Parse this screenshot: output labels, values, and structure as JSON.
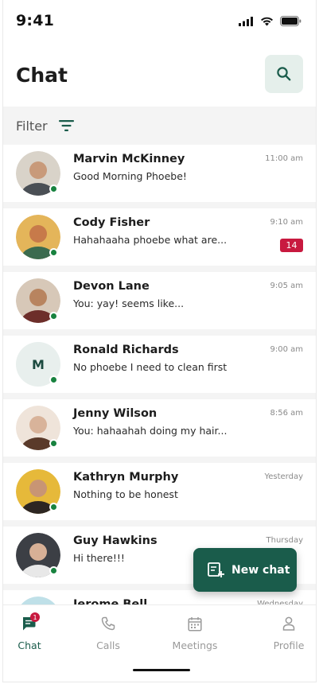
{
  "status_bar": {
    "time": "9:41"
  },
  "header": {
    "title": "Chat"
  },
  "filter": {
    "label": "Filter"
  },
  "chats": [
    {
      "name": "Marvin McKinney",
      "preview": "Good Morning Phoebe!",
      "time": "11:00 am",
      "unread": "",
      "online": true,
      "avatar_initial": "",
      "avatar_colors": [
        "#c89a7a",
        "#4a4f55",
        "#d9d3c9"
      ]
    },
    {
      "name": "Cody Fisher",
      "preview": "Hahahaaha phoebe what are...",
      "time": "9:10 am",
      "unread": "14",
      "online": true,
      "avatar_initial": "",
      "avatar_colors": [
        "#c77a4a",
        "#3b6b4e",
        "#e4b55a"
      ]
    },
    {
      "name": "Devon Lane",
      "preview": "You: yay! seems like...",
      "time": "9:05 am",
      "unread": "",
      "online": true,
      "avatar_initial": "",
      "avatar_colors": [
        "#b8845f",
        "#6d2e2a",
        "#d7c8b8"
      ]
    },
    {
      "name": "Ronald Richards",
      "preview": "No phoebe I need to clean first",
      "time": "9:00 am",
      "unread": "",
      "online": true,
      "avatar_initial": "M",
      "avatar_colors": []
    },
    {
      "name": "Jenny Wilson",
      "preview": "You: hahaahah doing my hair...",
      "time": "8:56 am",
      "unread": "",
      "online": true,
      "avatar_initial": "",
      "avatar_colors": [
        "#d8b39a",
        "#5a3a2a",
        "#efe4da"
      ]
    },
    {
      "name": "Kathryn Murphy",
      "preview": "Nothing to be honest",
      "time": "Yesterday",
      "unread": "",
      "online": true,
      "avatar_initial": "",
      "avatar_colors": [
        "#c89574",
        "#2d2622",
        "#e6b93a"
      ]
    },
    {
      "name": "Guy Hawkins",
      "preview": "Hi there!!!",
      "time": "Thursday",
      "unread": "",
      "online": true,
      "avatar_initial": "",
      "avatar_colors": [
        "#d7b096",
        "#e8e8e8",
        "#3c3f45"
      ]
    },
    {
      "name": "Jerome Bell",
      "preview": "",
      "time": "Wednesday",
      "unread": "",
      "online": false,
      "avatar_initial": "",
      "avatar_colors": [
        "#bfe0e8",
        "#bfe0e8",
        "#bfe0e8"
      ]
    }
  ],
  "fab": {
    "label": "New chat"
  },
  "bottom_nav": {
    "items": [
      {
        "label": "Chat",
        "icon": "chat-icon",
        "badge": "1",
        "active": true
      },
      {
        "label": "Calls",
        "icon": "phone-icon",
        "badge": "",
        "active": false
      },
      {
        "label": "Meetings",
        "icon": "calendar-icon",
        "badge": "",
        "active": false
      },
      {
        "label": "Profile",
        "icon": "person-icon",
        "badge": "",
        "active": false
      }
    ]
  },
  "colors": {
    "accent": "#1a5c4b",
    "accent_light": "#e5efeb",
    "badge": "#c8193f",
    "online": "#18823f"
  }
}
